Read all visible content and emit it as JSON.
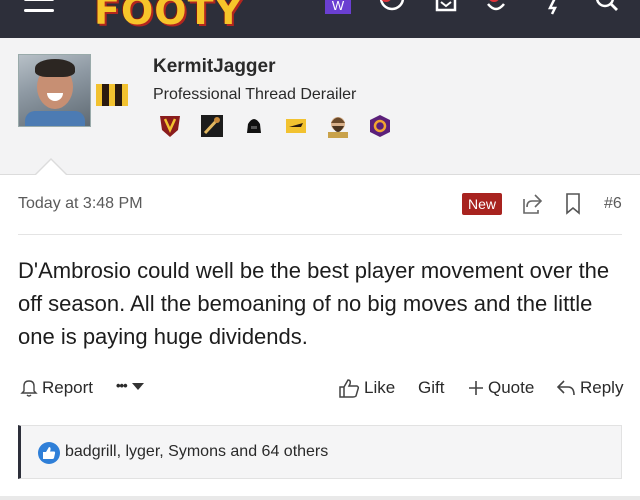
{
  "header": {
    "logo_text": "FOOTY",
    "w_badge": "W"
  },
  "member": {
    "username": "KermitJagger",
    "title": "Professional Thread Derailer",
    "club_colors": [
      "#f2c230",
      "#2a1a10",
      "#f2c230",
      "#2a1a10",
      "#f2c230"
    ],
    "trophy_icons": [
      "v-shield-icon",
      "sword-icon",
      "darth-vader-icon",
      "plane-icon",
      "bearded-man-icon",
      "hexagon-badge-icon"
    ]
  },
  "post": {
    "date": "Today at 3:48 PM",
    "new_label": "New",
    "number": "#6",
    "body": "D'Ambrosio could well be the best player movement over the off season. All the bemoaning of no big moves and the little one is paying huge dividends."
  },
  "actions": {
    "report": "Report",
    "more": "•••",
    "like": "Like",
    "gift": "Gift",
    "quote": "Quote",
    "reply": "Reply"
  },
  "reactions": {
    "text": "badgrill, lyger, Symons and 64 others"
  },
  "colors": {
    "nav_bg": "#2d2f3a",
    "new_badge": "#a8231f",
    "like_blue": "#2f7fd8"
  }
}
